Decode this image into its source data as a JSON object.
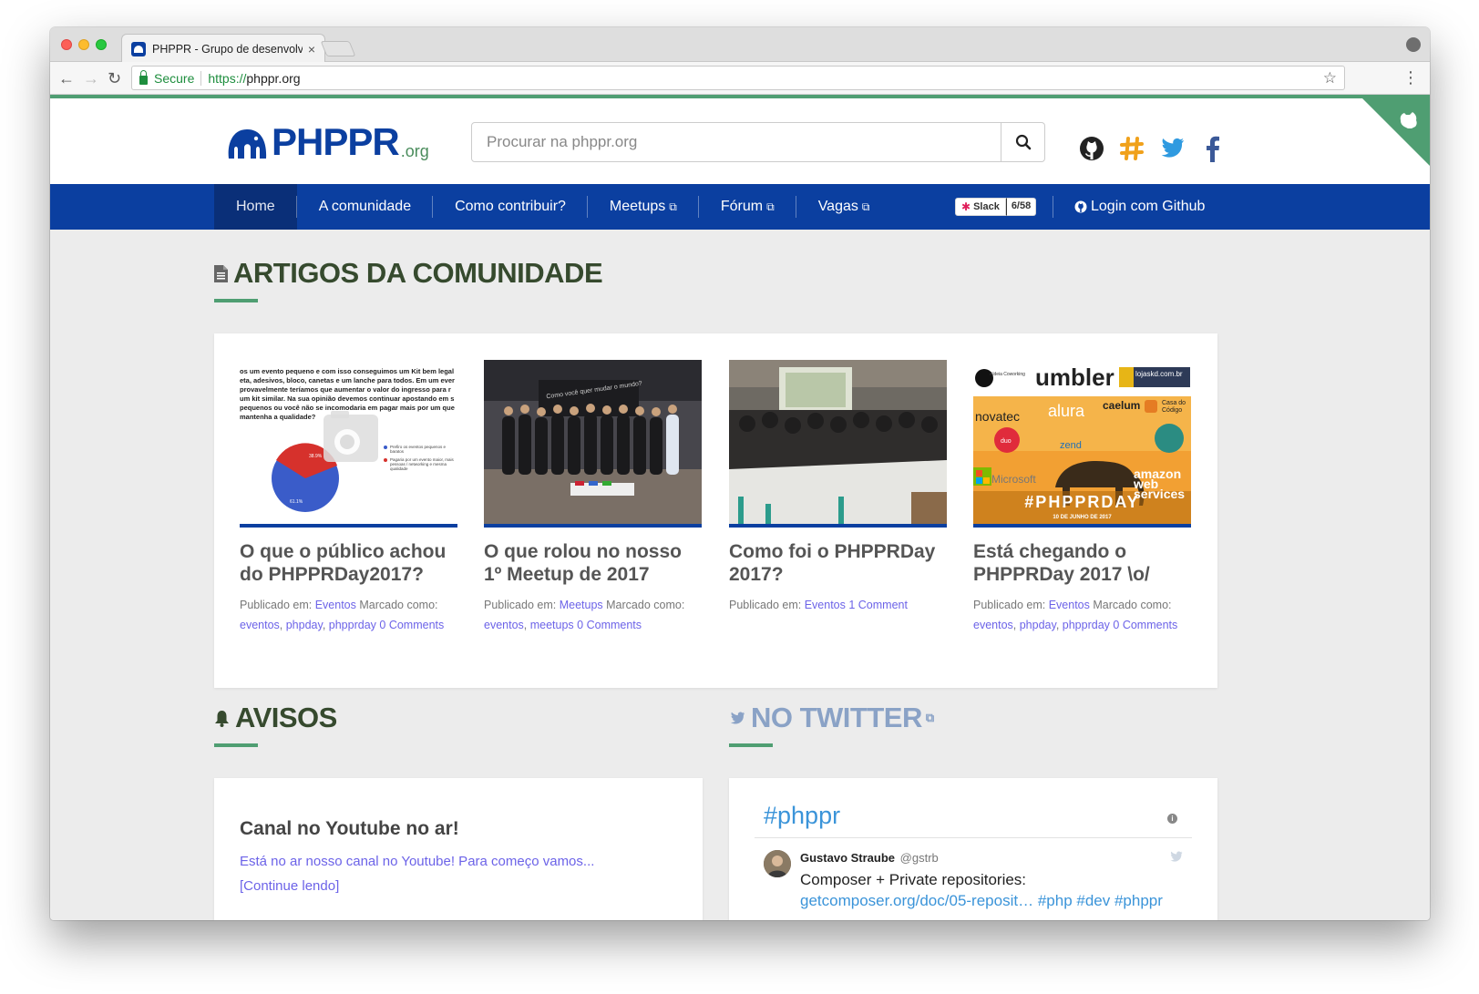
{
  "browser": {
    "tab_title": "PHPPR - Grupo de desenvolve",
    "tab_close": "×",
    "secure_label": "Secure",
    "url_scheme": "https://",
    "url_host": "phppr.org"
  },
  "header": {
    "logo_text": "PHPPR",
    "logo_suffix": ".org",
    "search_placeholder": "Procurar na phppr.org",
    "social_icons": [
      "github-icon",
      "slack-icon",
      "twitter-icon",
      "facebook-icon"
    ]
  },
  "nav": {
    "items": [
      "Home",
      "A comunidade",
      "Como contribuir?",
      "Meetups",
      "Fórum",
      "Vagas"
    ],
    "active": "Home",
    "slack_label": "Slack",
    "slack_count": "6/58",
    "login_label": "Login com Github"
  },
  "articles_section": {
    "title": "ARTIGOS DA COMUNIDADE",
    "articles": [
      {
        "title": "O que o público achou do PHPPRDay2017?",
        "published_label": "Publicado em:",
        "category": "Eventos",
        "tagged_label": "Marcado como:",
        "tags": [
          "eventos",
          "phpday",
          "phpprday"
        ],
        "comments": "0 Comments"
      },
      {
        "title": "O que rolou no nosso 1º Meetup de 2017",
        "published_label": "Publicado em:",
        "category": "Meetups",
        "tagged_label": "Marcado como:",
        "tags": [
          "eventos",
          "meetups"
        ],
        "comments": "0 Comments"
      },
      {
        "title": "Como foi o PHPPRDay 2017?",
        "published_label": "Publicado em:",
        "category": "Eventos",
        "comments": "1 Comment"
      },
      {
        "title": "Está chegando o PHPPRDay 2017 \\o/",
        "published_label": "Publicado em:",
        "category": "Eventos",
        "tagged_label": "Marcado como:",
        "tags": [
          "eventos",
          "phpday",
          "phpprday"
        ],
        "comments": "0 Comments"
      }
    ],
    "thumb1": {
      "text": "os um evento pequeno e com isso conseguimos um Kit bem legal eta, adesivos, bloco, canetas e um lanche para todos. Em um ever provavelmente teríamos que aumentar o valor do ingresso para r um kit similar. Na sua opinião devemos continuar apostando em s pequenos ou você não se incomodaria em pagar mais por um que mantenha a qualidade?",
      "pie_red_label": "38.9%",
      "pie_blue_label": "61.1%",
      "legend_1": "Prefiro os eventos pequenos e baratos",
      "legend_2": "Pagaria por um evento maior, mais pessoas / networking e mesma qualidade"
    },
    "thumb2": {
      "banner": "Como você quer mudar o mundo?"
    },
    "thumb4": {
      "sponsors": [
        "Aldeia Coworking",
        "umbler",
        "lojaskd.com.br",
        "novatec",
        "alura",
        "caelum",
        "Casa do Código",
        "duo",
        "zend",
        "Microsoft",
        "amazon web services"
      ],
      "hashtag": "#PHPPRDAY",
      "date": "10 DE JUNHO DE 2017"
    }
  },
  "avisos_section": {
    "title": "AVISOS",
    "post_title": "Canal no Youtube no ar!",
    "post_excerpt": "Está no ar nosso canal no Youtube! Para começo vamos...",
    "read_more": "[Continue lendo]"
  },
  "twitter_section": {
    "title": "NO TWITTER",
    "hashtag": "#phppr",
    "tweet": {
      "name": "Gustavo Straube",
      "handle": "@gstrb",
      "text": "Composer + Private repositories:",
      "link": "getcomposer.org/doc/05-reposit…",
      "hashtags": "#php #dev #phppr"
    }
  },
  "colors": {
    "brand_blue": "#0b3fa0",
    "brand_green": "#4f9e72",
    "link_purple": "#6c63e8",
    "twitter_blue": "#3b94d9"
  }
}
